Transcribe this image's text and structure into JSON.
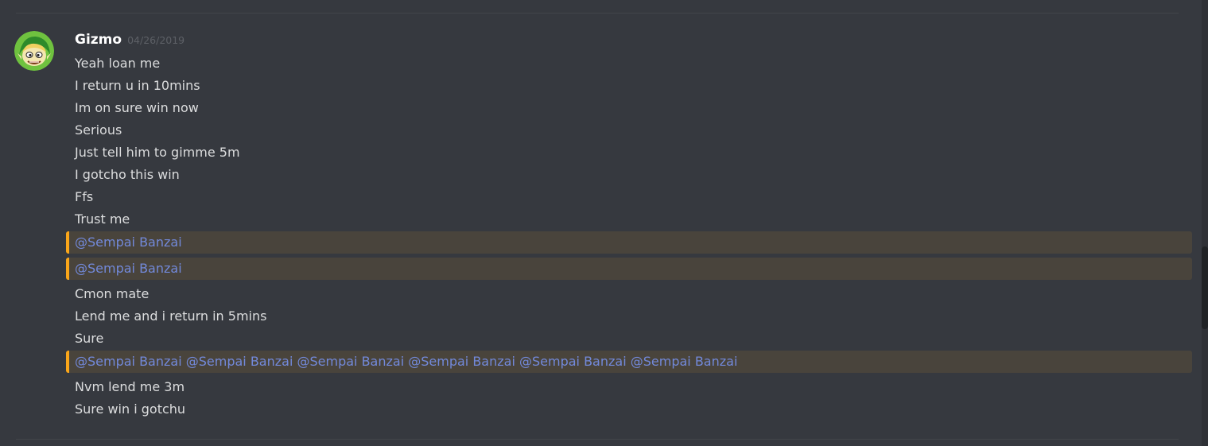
{
  "message_group": {
    "author": "Gizmo",
    "timestamp": "04/26/2019",
    "avatar_icon": "link-character-avatar",
    "lines": [
      {
        "text": "Yeah loan me"
      },
      {
        "text": "I return u in 10mins"
      },
      {
        "text": "Im on sure win now"
      },
      {
        "text": "Serious"
      },
      {
        "text": "Just tell him to gimme 5m"
      },
      {
        "text": "I gotcho this win"
      },
      {
        "text": "Ffs"
      },
      {
        "text": "Trust me"
      },
      {
        "mentions": [
          "@Sempai Banzai"
        ]
      },
      {
        "mentions": [
          "@Sempai Banzai"
        ]
      },
      {
        "text": "Cmon mate"
      },
      {
        "text": "Lend me and i return in 5mins"
      },
      {
        "text": "Sure"
      },
      {
        "mentions": [
          "@Sempai Banzai",
          "@Sempai Banzai",
          "@Sempai Banzai",
          "@Sempai Banzai",
          "@Sempai Banzai",
          "@Sempai Banzai"
        ]
      },
      {
        "text": "Nvm lend me 3m"
      },
      {
        "text": "Sure win i gotchu"
      }
    ]
  },
  "colors": {
    "background": "#36393f",
    "mention_highlight": "#49443c",
    "mention_bar": "#faa61a",
    "mention_text": "#7289da",
    "message_text": "#dcddde",
    "username": "#ffffff",
    "timestamp": "#5d6066"
  }
}
